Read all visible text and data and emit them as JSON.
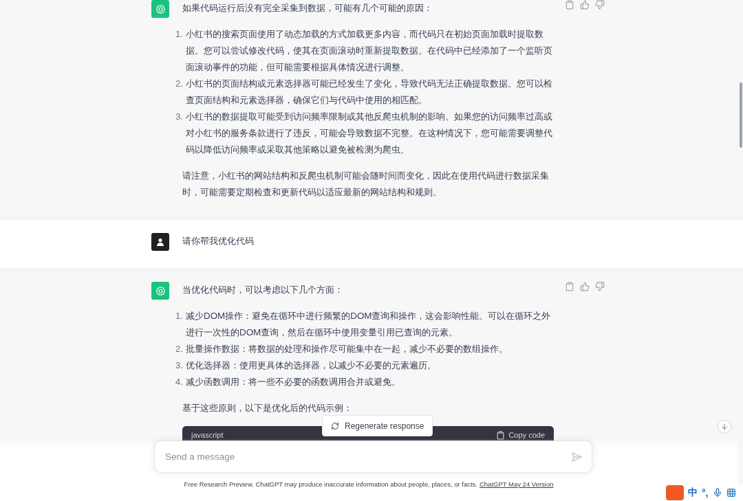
{
  "messages": [
    {
      "kind": "assistant",
      "paragraphs_before": [
        "如果代码运行后没有完全采集到数据，可能有几个可能的原因："
      ],
      "list": [
        {
          "number": "1.",
          "text": "小红书的搜索页面使用了动态加载的方式加载更多内容，而代码只在初始页面加载时提取数据。您可以尝试修改代码，使其在页面滚动时重新提取数据。在代码中已经添加了一个监听页面滚动事件的功能，但可能需要根据具体情况进行调整。"
        },
        {
          "number": "2.",
          "text": "小红书的页面结构或元素选择器可能已经发生了变化，导致代码无法正确提取数据。您可以检查页面结构和元素选择器，确保它们与代码中使用的相匹配。"
        },
        {
          "number": "3.",
          "text": "小红书的数据提取可能受到访问频率限制或其他反爬虫机制的影响。如果您的访问频率过高或对小红书的服务条款进行了违反，可能会导致数据不完整。在这种情况下，您可能需要调整代码以降低访问频率或采取其他策略以避免被检测为爬虫。"
        }
      ],
      "paragraphs_after": [
        "请注意，小红书的网站结构和反爬虫机制可能会随时间而变化，因此在使用代码进行数据采集时，可能需要定期检查和更新代码以适应最新的网站结构和规则。"
      ]
    },
    {
      "kind": "user",
      "paragraphs_before": [
        "请你帮我优化代码"
      ]
    },
    {
      "kind": "assistant",
      "paragraphs_before": [
        "当优化代码时，可以考虑以下几个方面："
      ],
      "list": [
        {
          "number": "1.",
          "text": "减少DOM操作：避免在循环中进行频繁的DOM查询和操作，这会影响性能。可以在循环之外进行一次性的DOM查询，然后在循环中使用变量引用已查询的元素。"
        },
        {
          "number": "2.",
          "text": "批量操作数据：将数据的处理和操作尽可能集中在一起，减少不必要的数组操作。"
        },
        {
          "number": "3.",
          "text": "优化选择器：使用更具体的选择器，以减少不必要的元素遍历。"
        },
        {
          "number": "4.",
          "text": "减少函数调用：将一些不必要的函数调用合并或避免。"
        }
      ],
      "paragraphs_after": [
        "基于这些原则，以下是优化后的代码示例："
      ],
      "code_block": {
        "language": "javascript",
        "copy_label": "Copy code"
      }
    }
  ],
  "regenerate_button": "Regenerate response",
  "composer": {
    "placeholder": "Send a message"
  },
  "disclaimer": {
    "text": "Free Research Preview. ChatGPT may produce inaccurate information about people, places, or facts.",
    "link": "ChatGPT May 24 Version"
  },
  "ime_toolbar": {
    "language": "中",
    "punctuation": "°,"
  }
}
